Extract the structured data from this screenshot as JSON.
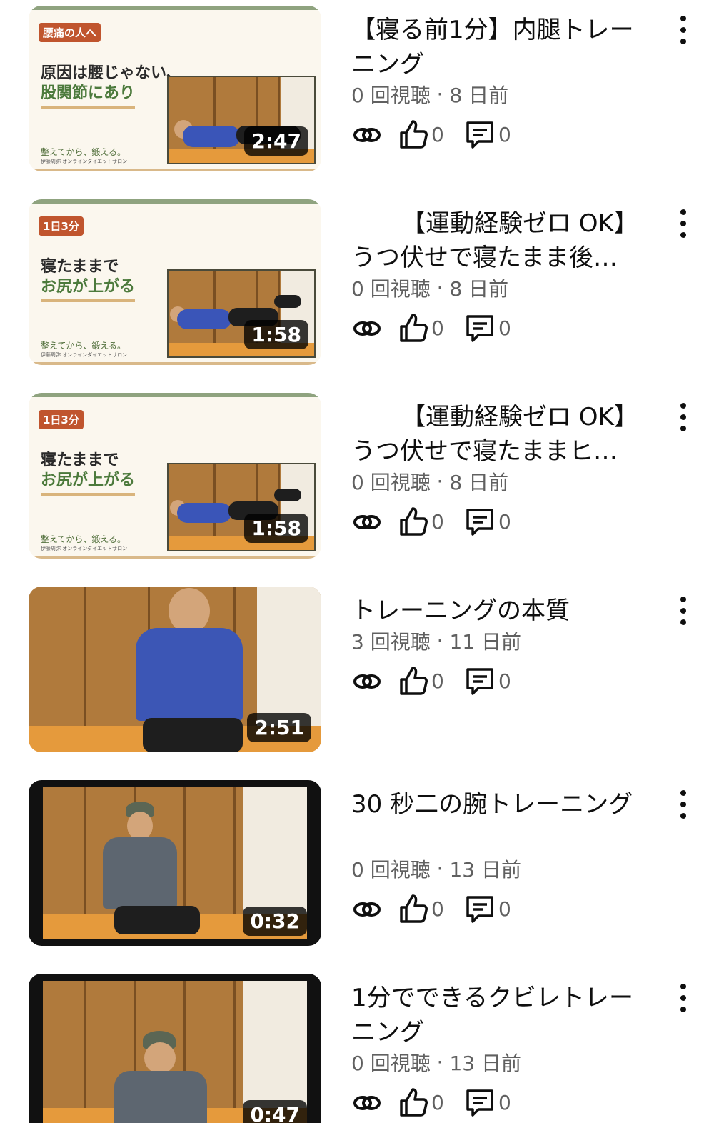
{
  "videos": [
    {
      "title": "【寝る前1分】内腿トレーニング",
      "views": "0 回視聴",
      "sep": "·",
      "age": "8 日前",
      "duration": "2:47",
      "likes": "0",
      "comments": "0",
      "thumb": {
        "tag": "腰痛の人へ",
        "line1": "原因は腰じゃない、",
        "line2": "股関節にあり",
        "footer1": "整えてから、鍛える。",
        "footer2": "伊藤周弥 オンラインダイエットサロン"
      }
    },
    {
      "title": "【運動経験ゼロ OK】うつ伏せで寝たまま後…",
      "views": "0 回視聴",
      "sep": "·",
      "age": "8 日前",
      "duration": "1:58",
      "likes": "0",
      "comments": "0",
      "thumb": {
        "tag": "1日3分",
        "line1": "寝たままで",
        "line2": "お尻が上がる",
        "footer1": "整えてから、鍛える。",
        "footer2": "伊藤周弥 オンラインダイエットサロン"
      }
    },
    {
      "title": "【運動経験ゼロ OK】うつ伏せで寝たままヒ…",
      "views": "0 回視聴",
      "sep": "·",
      "age": "8 日前",
      "duration": "1:58",
      "likes": "0",
      "comments": "0",
      "thumb": {
        "tag": "1日3分",
        "line1": "寝たままで",
        "line2": "お尻が上がる",
        "footer1": "整えてから、鍛える。",
        "footer2": "伊藤周弥 オンラインダイエットサロン"
      }
    },
    {
      "title": "トレーニングの本質",
      "views": "3 回視聴",
      "sep": "·",
      "age": "11 日前",
      "duration": "2:51",
      "likes": "0",
      "comments": "0"
    },
    {
      "title": "30 秒二の腕トレーニング",
      "views": "0 回視聴",
      "sep": "·",
      "age": "13 日前",
      "duration": "0:32",
      "likes": "0",
      "comments": "0"
    },
    {
      "title": "1分でできるクビレトレーニング",
      "views": "0 回視聴",
      "sep": "·",
      "age": "13 日前",
      "duration": "0:47",
      "likes": "0",
      "comments": "0"
    }
  ],
  "icons": {
    "share": "link-icon",
    "like": "thumbs-up-icon",
    "comment": "comment-icon",
    "more": "more-vertical-icon"
  }
}
